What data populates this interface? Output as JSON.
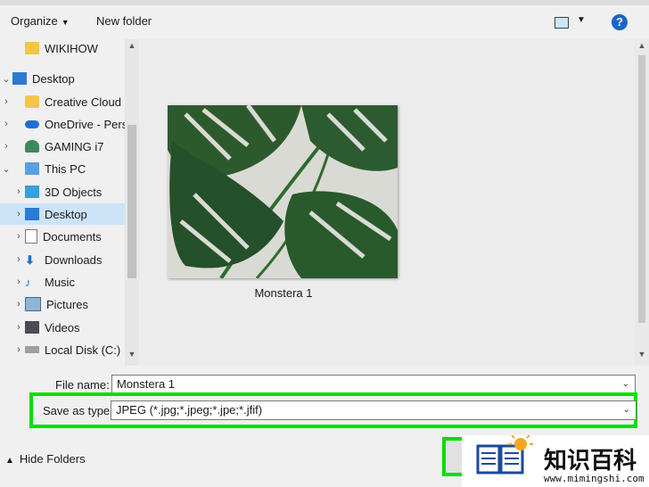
{
  "toolbar": {
    "organize": "Organize",
    "new_folder": "New folder",
    "help": "?"
  },
  "nav": {
    "items": [
      {
        "label": "WIKIHOW",
        "icon": "folder-icon",
        "chevron": ""
      },
      {
        "label": "Desktop",
        "icon": "desktop-icon",
        "chevron": "⌄"
      },
      {
        "label": "Creative Cloud F",
        "icon": "creative-cloud-icon",
        "chevron": "›"
      },
      {
        "label": "OneDrive - Perso",
        "icon": "onedrive-icon",
        "chevron": "›"
      },
      {
        "label": "GAMING i7",
        "icon": "user-icon",
        "chevron": "›"
      },
      {
        "label": "This PC",
        "icon": "computer-icon",
        "chevron": "⌄"
      },
      {
        "label": "3D Objects",
        "icon": "3d-objects-icon",
        "chevron": "›"
      },
      {
        "label": "Desktop",
        "icon": "desktop-icon",
        "chevron": "›"
      },
      {
        "label": "Documents",
        "icon": "documents-icon",
        "chevron": "›"
      },
      {
        "label": "Downloads",
        "icon": "downloads-icon",
        "chevron": "›"
      },
      {
        "label": "Music",
        "icon": "music-icon",
        "chevron": "›"
      },
      {
        "label": "Pictures",
        "icon": "pictures-icon",
        "chevron": "›"
      },
      {
        "label": "Videos",
        "icon": "videos-icon",
        "chevron": "›"
      },
      {
        "label": "Local Disk (C:)",
        "icon": "disk-icon",
        "chevron": "›"
      }
    ]
  },
  "content": {
    "file_label": "Monstera 1"
  },
  "form": {
    "file_name_label": "File name:",
    "file_name_value": "Monstera 1",
    "save_type_label": "Save as type:",
    "save_type_value": "JPEG (*.jpg;*.jpeg;*.jpe;*.jfif)"
  },
  "footer": {
    "hide_folders": "Hide Folders"
  },
  "watermark": {
    "title": "知识百科",
    "url": "www.mimingshi.com"
  },
  "colors": {
    "highlight": "#00e000",
    "selected": "#cce4f7",
    "help": "#1a64c8"
  }
}
